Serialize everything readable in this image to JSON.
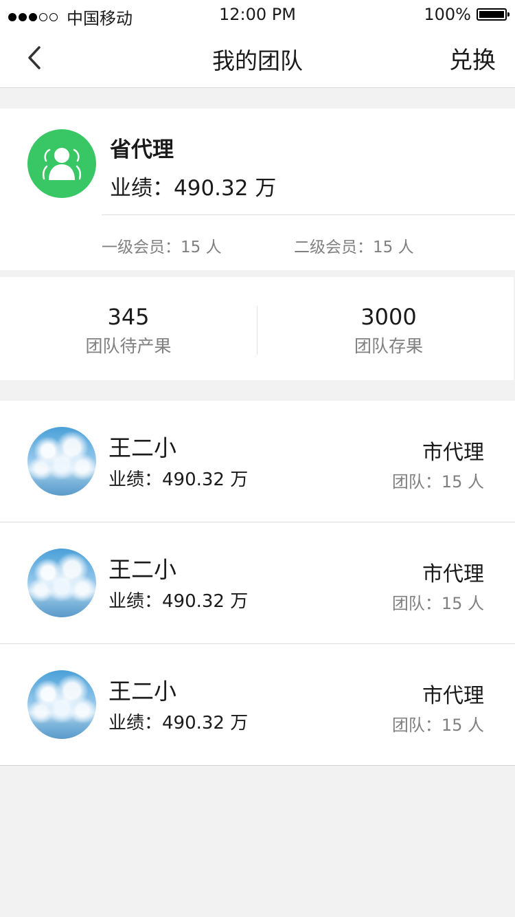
{
  "status_bar": {
    "carrier": "中国移动",
    "time": "12:00 PM",
    "battery": "100%"
  },
  "nav": {
    "title": "我的团队",
    "action_label": "兑换",
    "back_icon": "chevron-left-icon"
  },
  "profile": {
    "avatar_icon": "users-icon",
    "avatar_color": "#39c765",
    "level": "省代理",
    "performance": "业绩：490.32 万",
    "level1_members": "一级会员：15 人",
    "level2_members": "二级会员：15 人"
  },
  "stats": [
    {
      "value": "345",
      "label": "团队待产果"
    },
    {
      "value": "3000",
      "label": "团队存果"
    }
  ],
  "members": [
    {
      "name": "王二小",
      "performance": "业绩：490.32 万",
      "level": "市代理",
      "team": "团队：15 人"
    },
    {
      "name": "王二小",
      "performance": "业绩：490.32 万",
      "level": "市代理",
      "team": "团队：15 人"
    },
    {
      "name": "王二小",
      "performance": "业绩：490.32 万",
      "level": "市代理",
      "team": "团队：15 人"
    }
  ]
}
